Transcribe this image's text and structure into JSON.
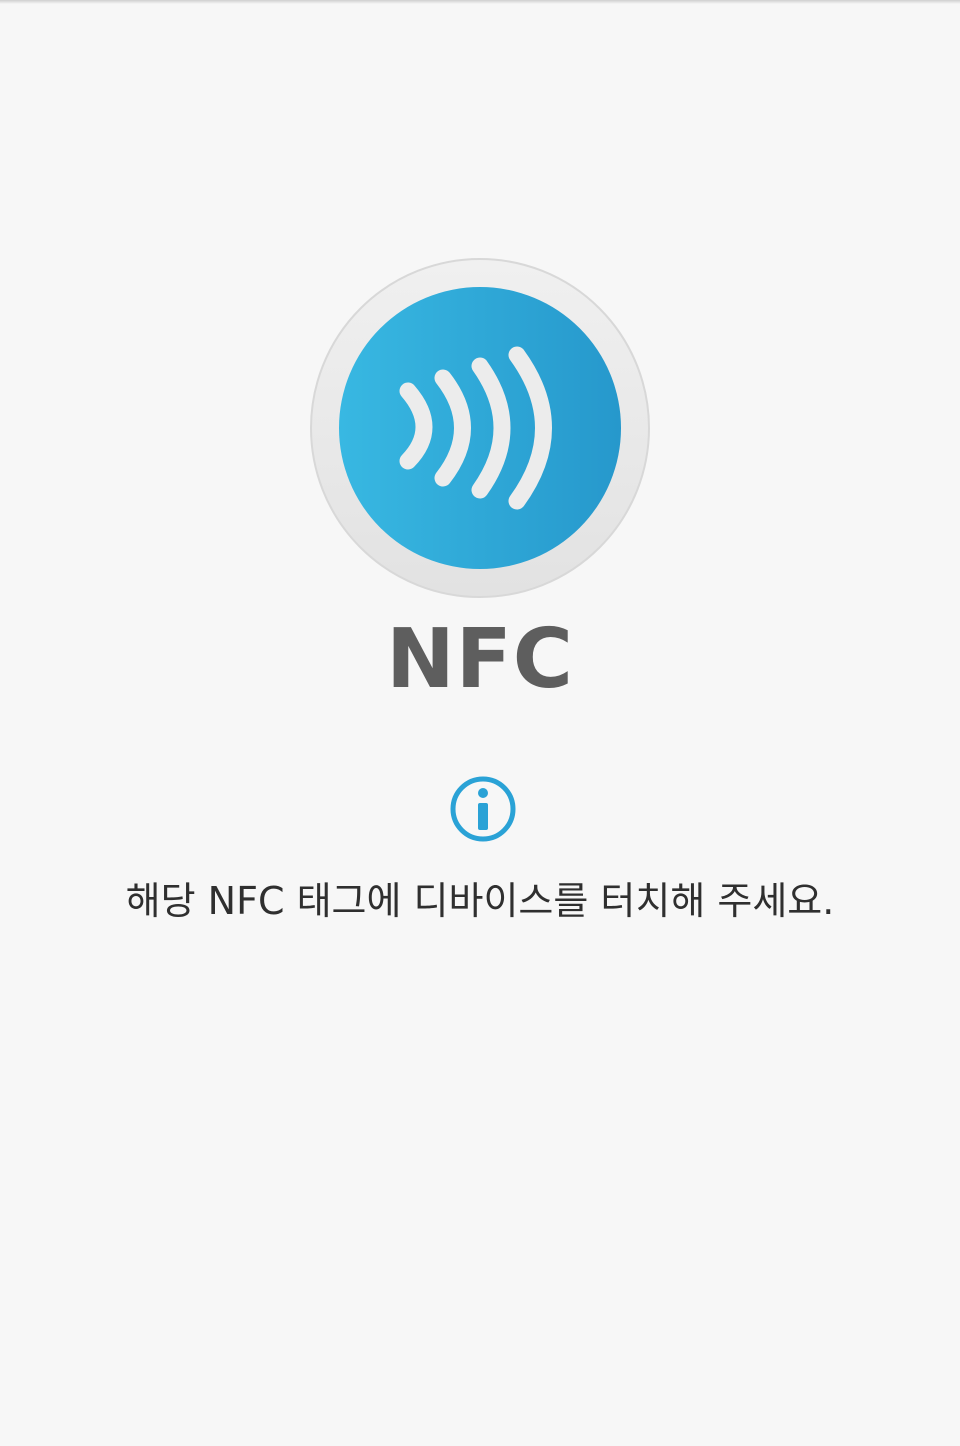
{
  "screen": {
    "title": "NFC",
    "instruction": "해당 NFC 태그에 디바이스를 터치해 주세요."
  },
  "icons": {
    "nfc_badge": "nfc-contactless-icon",
    "info": "info-icon"
  },
  "colors": {
    "background": "#f7f7f7",
    "accent": "#2aa2d6",
    "title_text": "#5e5e5e",
    "body_text": "#2f2f2f"
  }
}
